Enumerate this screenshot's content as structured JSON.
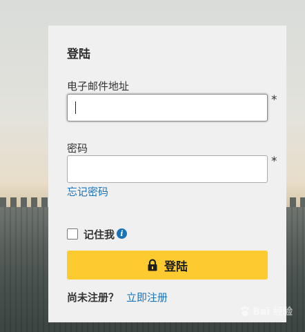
{
  "login": {
    "title": "登陆",
    "email_label": "电子邮件地址",
    "email_value": "",
    "password_label": "密码",
    "password_value": "",
    "required_mark": "*",
    "forgot_password": "忘记密码",
    "remember_me": "记住我",
    "info_glyph": "i",
    "submit_label": "登陆",
    "no_account": "尚未注册？",
    "register_link": "立即注册"
  },
  "watermark": {
    "text": "Bai 经验"
  },
  "colors": {
    "accent_button": "#fdcb2f",
    "link": "#1a73b8",
    "card_bg": "#f0f0f0"
  },
  "icons": [
    "lock-icon",
    "info-icon",
    "baidu-paw-icon"
  ]
}
